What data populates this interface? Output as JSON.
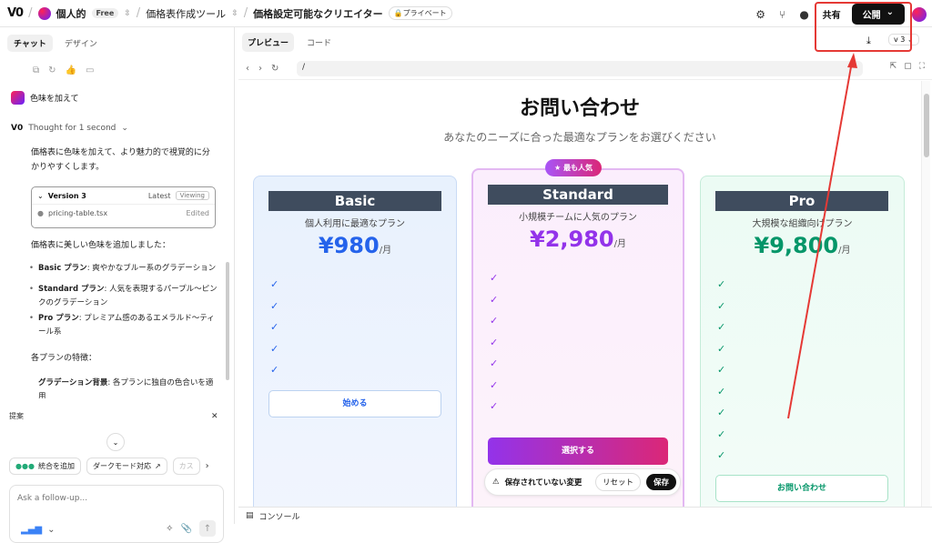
{
  "topbar": {
    "logo": "V0",
    "workspace": "個人的",
    "plan_badge": "Free",
    "project": "価格表作成ツール",
    "chat_title": "価格設定可能なクリエイター",
    "privacy": "プライベート",
    "share_label": "共有",
    "publish_label": "公開"
  },
  "left": {
    "tabs": [
      "チャット",
      "デザイン"
    ],
    "user_message": "色味を加えて",
    "thought": "Thought for 1 second",
    "intro": "価格表に色味を加えて、より魅力的で視覚的に分かりやすくします。",
    "version": {
      "title": "Version 3",
      "latest": "Latest",
      "viewing": "Viewing",
      "file": "pricing-table.tsx",
      "status": "Edited"
    },
    "added_heading": "価格表に美しい色味を追加しました：",
    "bullets": [
      {
        "bold": "Basic プラン",
        "text": ": 爽やかなブルー系のグラデーション"
      },
      {
        "bold": "Standard プラン",
        "text": ": 人気を表現するパープル〜ピンクのグラデーション"
      },
      {
        "bold": "Pro プラン",
        "text": ": プレミアム感のあるエメラルド〜ティール系"
      }
    ],
    "features_heading": "各プランの特徴：",
    "feature_bullet": {
      "bold": "グラデーション背景",
      "text": ": 各プランに独自の色合いを適用"
    },
    "suggest_label": "提案",
    "chips": [
      "統合を追加",
      "ダークモード対応",
      "カス"
    ],
    "compose_placeholder": "Ask a follow-up..."
  },
  "right": {
    "tabs": [
      "プレビュー",
      "コード"
    ],
    "version_select": "v 3",
    "url": "/",
    "console_label": "コンソール"
  },
  "preview": {
    "title": "お問い合わせ",
    "subtitle": "あなたのニーズに合った最適なプランをお選びください",
    "popular_badge": "最も人気",
    "plans": [
      {
        "name": "Basic",
        "desc": "個人利用に最適なプラン",
        "price": "¥980",
        "unit": "/月",
        "button": "始める",
        "color": "#2563eb",
        "checks": 5
      },
      {
        "name": "Standard",
        "desc": "小規模チームに人気のプラン",
        "price": "¥2,980",
        "unit": "/月",
        "button": "選択する",
        "color": "#9333ea",
        "checks": 7
      },
      {
        "name": "Pro",
        "desc": "大規模な組織向けプラン",
        "price": "¥9,800",
        "unit": "/月",
        "button": "お問い合わせ",
        "color": "#059669",
        "checks": 9
      }
    ],
    "unsaved": {
      "message": "保存されていない変更",
      "reset": "リセット",
      "save": "保存"
    }
  }
}
